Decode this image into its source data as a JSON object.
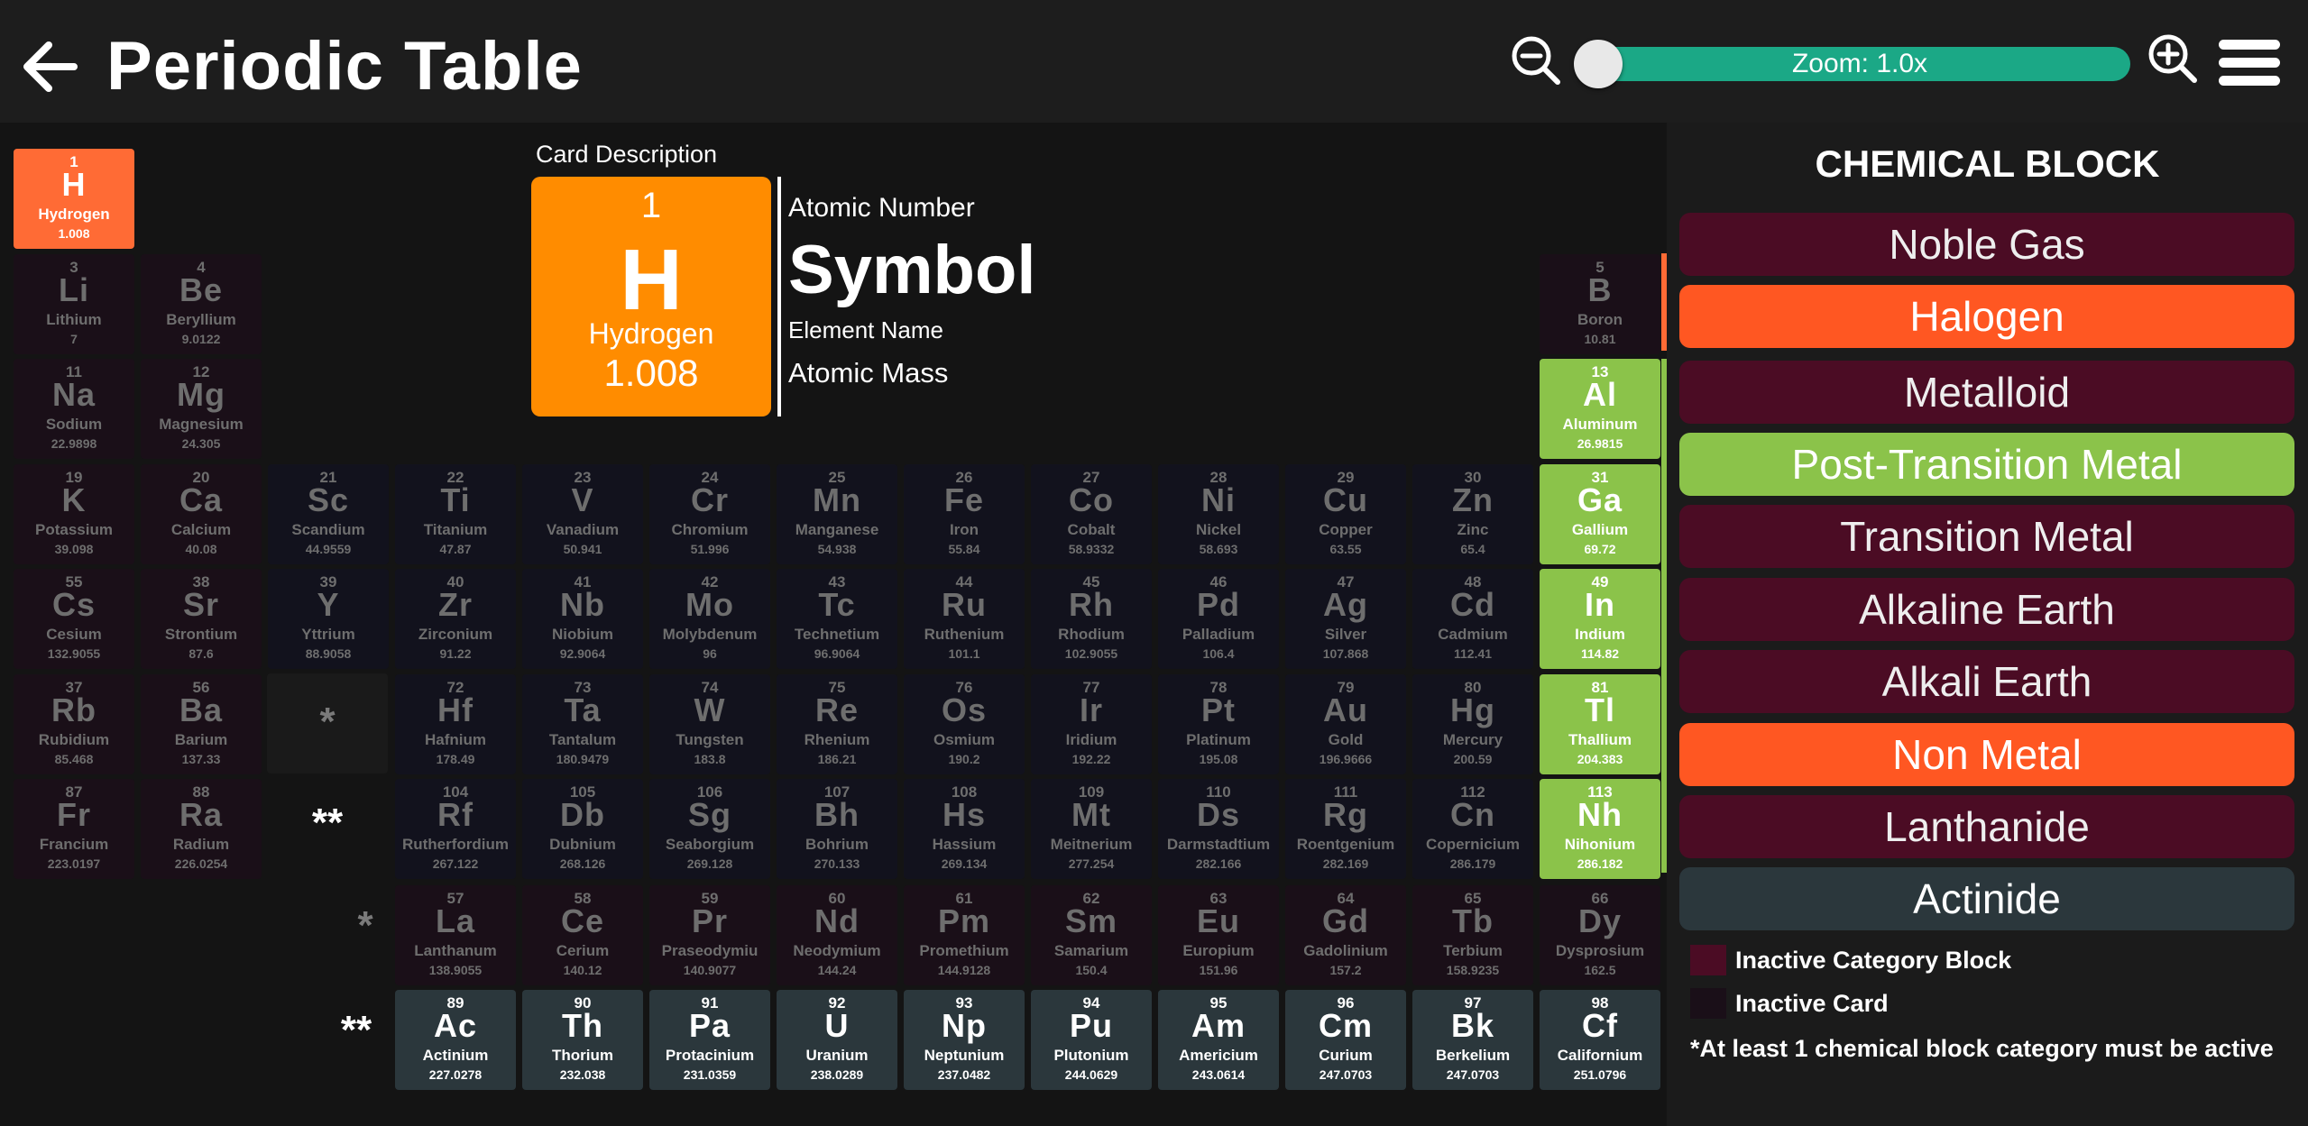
{
  "header": {
    "title": "Periodic Table",
    "zoom_label": "Zoom: 1.0x"
  },
  "icons": {
    "back": "arrow-left-icon",
    "zoom_out": "zoom-out-icon",
    "zoom_in": "zoom-in-icon",
    "menu": "hamburger-menu-icon"
  },
  "zoom_slider": {
    "min": 1.0,
    "value": 1.0
  },
  "colors": {
    "header_bg": "#1d1d1d",
    "background": "#141414",
    "panel_bg": "#1b1b1b",
    "zoom_track": "#1ba886",
    "description_card": "#ff8c00",
    "hydrogen_card": "#ff6b35",
    "post_transition": "#8bc34a",
    "halogen_nonmetal": "#ff5722",
    "actinide": "#2b373c",
    "inactive_category": "#4b0c24",
    "inactive_card": "#1a0f18"
  },
  "description": {
    "caption": "Card Description",
    "number": "1",
    "symbol": "H",
    "name": "Hydrogen",
    "mass": "1.008",
    "label_number": "Atomic Number",
    "label_symbol": "Symbol",
    "label_name": "Element Name",
    "label_mass": "Atomic Mass"
  },
  "markers": {
    "lanthanide": "*",
    "actinide": "**"
  },
  "elements": [
    {
      "n": "1",
      "s": "H",
      "name": "Hydrogen",
      "m": "1.008",
      "row": 0,
      "col": 0,
      "cat": "hydrogen"
    },
    {
      "n": "3",
      "s": "Li",
      "name": "Lithium",
      "m": "7",
      "row": 1,
      "col": 0,
      "cat": "inactive"
    },
    {
      "n": "4",
      "s": "Be",
      "name": "Beryllium",
      "m": "9.0122",
      "row": 1,
      "col": 1,
      "cat": "inactive"
    },
    {
      "n": "5",
      "s": "B",
      "name": "Boron",
      "m": "10.81",
      "row": 1,
      "col": 12,
      "cat": "inactive"
    },
    {
      "n": "11",
      "s": "Na",
      "name": "Sodium",
      "m": "22.9898",
      "row": 2,
      "col": 0,
      "cat": "inactive"
    },
    {
      "n": "12",
      "s": "Mg",
      "name": "Magnesium",
      "m": "24.305",
      "row": 2,
      "col": 1,
      "cat": "inactive"
    },
    {
      "n": "13",
      "s": "Al",
      "name": "Aluminum",
      "m": "26.9815",
      "row": 2,
      "col": 12,
      "cat": "post"
    },
    {
      "n": "19",
      "s": "K",
      "name": "Potassium",
      "m": "39.098",
      "row": 3,
      "col": 0,
      "cat": "inactive"
    },
    {
      "n": "20",
      "s": "Ca",
      "name": "Calcium",
      "m": "40.08",
      "row": 3,
      "col": 1,
      "cat": "inactive"
    },
    {
      "n": "21",
      "s": "Sc",
      "name": "Scandium",
      "m": "44.9559",
      "row": 3,
      "col": 2,
      "cat": "trans"
    },
    {
      "n": "22",
      "s": "Ti",
      "name": "Titanium",
      "m": "47.87",
      "row": 3,
      "col": 3,
      "cat": "trans"
    },
    {
      "n": "23",
      "s": "V",
      "name": "Vanadium",
      "m": "50.941",
      "row": 3,
      "col": 4,
      "cat": "trans"
    },
    {
      "n": "24",
      "s": "Cr",
      "name": "Chromium",
      "m": "51.996",
      "row": 3,
      "col": 5,
      "cat": "trans"
    },
    {
      "n": "25",
      "s": "Mn",
      "name": "Manganese",
      "m": "54.938",
      "row": 3,
      "col": 6,
      "cat": "trans"
    },
    {
      "n": "26",
      "s": "Fe",
      "name": "Iron",
      "m": "55.84",
      "row": 3,
      "col": 7,
      "cat": "trans"
    },
    {
      "n": "27",
      "s": "Co",
      "name": "Cobalt",
      "m": "58.9332",
      "row": 3,
      "col": 8,
      "cat": "trans"
    },
    {
      "n": "28",
      "s": "Ni",
      "name": "Nickel",
      "m": "58.693",
      "row": 3,
      "col": 9,
      "cat": "trans"
    },
    {
      "n": "29",
      "s": "Cu",
      "name": "Copper",
      "m": "63.55",
      "row": 3,
      "col": 10,
      "cat": "trans"
    },
    {
      "n": "30",
      "s": "Zn",
      "name": "Zinc",
      "m": "65.4",
      "row": 3,
      "col": 11,
      "cat": "trans"
    },
    {
      "n": "31",
      "s": "Ga",
      "name": "Gallium",
      "m": "69.72",
      "row": 3,
      "col": 12,
      "cat": "post"
    },
    {
      "n": "55",
      "s": "Cs",
      "name": "Cesium",
      "m": "132.9055",
      "row": 4,
      "col": 0,
      "cat": "inactive"
    },
    {
      "n": "38",
      "s": "Sr",
      "name": "Strontium",
      "m": "87.6",
      "row": 4,
      "col": 1,
      "cat": "inactive"
    },
    {
      "n": "39",
      "s": "Y",
      "name": "Yttrium",
      "m": "88.9058",
      "row": 4,
      "col": 2,
      "cat": "trans"
    },
    {
      "n": "40",
      "s": "Zr",
      "name": "Zirconium",
      "m": "91.22",
      "row": 4,
      "col": 3,
      "cat": "trans"
    },
    {
      "n": "41",
      "s": "Nb",
      "name": "Niobium",
      "m": "92.9064",
      "row": 4,
      "col": 4,
      "cat": "trans"
    },
    {
      "n": "42",
      "s": "Mo",
      "name": "Molybdenum",
      "m": "96",
      "row": 4,
      "col": 5,
      "cat": "trans"
    },
    {
      "n": "43",
      "s": "Tc",
      "name": "Technetium",
      "m": "96.9064",
      "row": 4,
      "col": 6,
      "cat": "trans"
    },
    {
      "n": "44",
      "s": "Ru",
      "name": "Ruthenium",
      "m": "101.1",
      "row": 4,
      "col": 7,
      "cat": "trans"
    },
    {
      "n": "45",
      "s": "Rh",
      "name": "Rhodium",
      "m": "102.9055",
      "row": 4,
      "col": 8,
      "cat": "trans"
    },
    {
      "n": "46",
      "s": "Pd",
      "name": "Palladium",
      "m": "106.4",
      "row": 4,
      "col": 9,
      "cat": "trans"
    },
    {
      "n": "47",
      "s": "Ag",
      "name": "Silver",
      "m": "107.868",
      "row": 4,
      "col": 10,
      "cat": "trans"
    },
    {
      "n": "48",
      "s": "Cd",
      "name": "Cadmium",
      "m": "112.41",
      "row": 4,
      "col": 11,
      "cat": "trans"
    },
    {
      "n": "49",
      "s": "In",
      "name": "Indium",
      "m": "114.82",
      "row": 4,
      "col": 12,
      "cat": "post"
    },
    {
      "n": "37",
      "s": "Rb",
      "name": "Rubidium",
      "m": "85.468",
      "row": 5,
      "col": 0,
      "cat": "inactive"
    },
    {
      "n": "56",
      "s": "Ba",
      "name": "Barium",
      "m": "137.33",
      "row": 5,
      "col": 1,
      "cat": "inactive"
    },
    {
      "n": "72",
      "s": "Hf",
      "name": "Hafnium",
      "m": "178.49",
      "row": 5,
      "col": 3,
      "cat": "trans"
    },
    {
      "n": "73",
      "s": "Ta",
      "name": "Tantalum",
      "m": "180.9479",
      "row": 5,
      "col": 4,
      "cat": "trans"
    },
    {
      "n": "74",
      "s": "W",
      "name": "Tungsten",
      "m": "183.8",
      "row": 5,
      "col": 5,
      "cat": "trans"
    },
    {
      "n": "75",
      "s": "Re",
      "name": "Rhenium",
      "m": "186.21",
      "row": 5,
      "col": 6,
      "cat": "trans"
    },
    {
      "n": "76",
      "s": "Os",
      "name": "Osmium",
      "m": "190.2",
      "row": 5,
      "col": 7,
      "cat": "trans"
    },
    {
      "n": "77",
      "s": "Ir",
      "name": "Iridium",
      "m": "192.22",
      "row": 5,
      "col": 8,
      "cat": "trans"
    },
    {
      "n": "78",
      "s": "Pt",
      "name": "Platinum",
      "m": "195.08",
      "row": 5,
      "col": 9,
      "cat": "trans"
    },
    {
      "n": "79",
      "s": "Au",
      "name": "Gold",
      "m": "196.9666",
      "row": 5,
      "col": 10,
      "cat": "trans"
    },
    {
      "n": "80",
      "s": "Hg",
      "name": "Mercury",
      "m": "200.59",
      "row": 5,
      "col": 11,
      "cat": "trans"
    },
    {
      "n": "81",
      "s": "Tl",
      "name": "Thallium",
      "m": "204.383",
      "row": 5,
      "col": 12,
      "cat": "post"
    },
    {
      "n": "87",
      "s": "Fr",
      "name": "Francium",
      "m": "223.0197",
      "row": 6,
      "col": 0,
      "cat": "inactive"
    },
    {
      "n": "88",
      "s": "Ra",
      "name": "Radium",
      "m": "226.0254",
      "row": 6,
      "col": 1,
      "cat": "inactive"
    },
    {
      "n": "104",
      "s": "Rf",
      "name": "Rutherfordium",
      "m": "267.122",
      "row": 6,
      "col": 3,
      "cat": "trans"
    },
    {
      "n": "105",
      "s": "Db",
      "name": "Dubnium",
      "m": "268.126",
      "row": 6,
      "col": 4,
      "cat": "trans"
    },
    {
      "n": "106",
      "s": "Sg",
      "name": "Seaborgium",
      "m": "269.128",
      "row": 6,
      "col": 5,
      "cat": "trans"
    },
    {
      "n": "107",
      "s": "Bh",
      "name": "Bohrium",
      "m": "270.133",
      "row": 6,
      "col": 6,
      "cat": "trans"
    },
    {
      "n": "108",
      "s": "Hs",
      "name": "Hassium",
      "m": "269.134",
      "row": 6,
      "col": 7,
      "cat": "trans"
    },
    {
      "n": "109",
      "s": "Mt",
      "name": "Meitnerium",
      "m": "277.254",
      "row": 6,
      "col": 8,
      "cat": "trans"
    },
    {
      "n": "110",
      "s": "Ds",
      "name": "Darmstadtium",
      "m": "282.166",
      "row": 6,
      "col": 9,
      "cat": "trans"
    },
    {
      "n": "111",
      "s": "Rg",
      "name": "Roentgenium",
      "m": "282.169",
      "row": 6,
      "col": 10,
      "cat": "trans"
    },
    {
      "n": "112",
      "s": "Cn",
      "name": "Copernicium",
      "m": "286.179",
      "row": 6,
      "col": 11,
      "cat": "trans"
    },
    {
      "n": "113",
      "s": "Nh",
      "name": "Nihonium",
      "m": "286.182",
      "row": 6,
      "col": 12,
      "cat": "post"
    },
    {
      "n": "57",
      "s": "La",
      "name": "Lanthanum",
      "m": "138.9055",
      "row": 7,
      "col": 3,
      "cat": "inactive"
    },
    {
      "n": "58",
      "s": "Ce",
      "name": "Cerium",
      "m": "140.12",
      "row": 7,
      "col": 4,
      "cat": "inactive"
    },
    {
      "n": "59",
      "s": "Pr",
      "name": "Praseodymiu",
      "m": "140.9077",
      "row": 7,
      "col": 5,
      "cat": "inactive"
    },
    {
      "n": "60",
      "s": "Nd",
      "name": "Neodymium",
      "m": "144.24",
      "row": 7,
      "col": 6,
      "cat": "inactive"
    },
    {
      "n": "61",
      "s": "Pm",
      "name": "Promethium",
      "m": "144.9128",
      "row": 7,
      "col": 7,
      "cat": "inactive"
    },
    {
      "n": "62",
      "s": "Sm",
      "name": "Samarium",
      "m": "150.4",
      "row": 7,
      "col": 8,
      "cat": "inactive"
    },
    {
      "n": "63",
      "s": "Eu",
      "name": "Europium",
      "m": "151.96",
      "row": 7,
      "col": 9,
      "cat": "inactive"
    },
    {
      "n": "64",
      "s": "Gd",
      "name": "Gadolinium",
      "m": "157.2",
      "row": 7,
      "col": 10,
      "cat": "inactive"
    },
    {
      "n": "65",
      "s": "Tb",
      "name": "Terbium",
      "m": "158.9235",
      "row": 7,
      "col": 11,
      "cat": "inactive"
    },
    {
      "n": "66",
      "s": "Dy",
      "name": "Dysprosium",
      "m": "162.5",
      "row": 7,
      "col": 12,
      "cat": "inactive"
    },
    {
      "n": "89",
      "s": "Ac",
      "name": "Actinium",
      "m": "227.0278",
      "row": 8,
      "col": 3,
      "cat": "actinide"
    },
    {
      "n": "90",
      "s": "Th",
      "name": "Thorium",
      "m": "232.038",
      "row": 8,
      "col": 4,
      "cat": "actinide"
    },
    {
      "n": "91",
      "s": "Pa",
      "name": "Protacinium",
      "m": "231.0359",
      "row": 8,
      "col": 5,
      "cat": "actinide"
    },
    {
      "n": "92",
      "s": "U",
      "name": "Uranium",
      "m": "238.0289",
      "row": 8,
      "col": 6,
      "cat": "actinide"
    },
    {
      "n": "93",
      "s": "Np",
      "name": "Neptunium",
      "m": "237.0482",
      "row": 8,
      "col": 7,
      "cat": "actinide"
    },
    {
      "n": "94",
      "s": "Pu",
      "name": "Plutonium",
      "m": "244.0629",
      "row": 8,
      "col": 8,
      "cat": "actinide"
    },
    {
      "n": "95",
      "s": "Am",
      "name": "Americium",
      "m": "243.0614",
      "row": 8,
      "col": 9,
      "cat": "actinide"
    },
    {
      "n": "96",
      "s": "Cm",
      "name": "Curium",
      "m": "247.0703",
      "row": 8,
      "col": 10,
      "cat": "actinide"
    },
    {
      "n": "97",
      "s": "Bk",
      "name": "Berkelium",
      "m": "247.0703",
      "row": 8,
      "col": 11,
      "cat": "actinide"
    },
    {
      "n": "98",
      "s": "Cf",
      "name": "Californium",
      "m": "251.0796",
      "row": 8,
      "col": 12,
      "cat": "actinide"
    }
  ],
  "panel": {
    "title": "CHEMICAL BLOCK",
    "categories": [
      {
        "label": "Noble Gas",
        "active": false
      },
      {
        "label": "Halogen",
        "active": true
      },
      {
        "label": "Metalloid",
        "active": false
      },
      {
        "label": "Post-Transition Metal",
        "active": true
      },
      {
        "label": "Transition Metal",
        "active": false
      },
      {
        "label": "Alkaline Earth",
        "active": false
      },
      {
        "label": "Alkali Earth",
        "active": false
      },
      {
        "label": "Non Metal",
        "active": true
      },
      {
        "label": "Lanthanide",
        "active": false
      },
      {
        "label": "Actinide",
        "active": true
      }
    ],
    "key_inactive_block": "Inactive Category Block",
    "key_inactive_card": "Inactive Card",
    "note": "*At least 1 chemical block category must be active"
  }
}
